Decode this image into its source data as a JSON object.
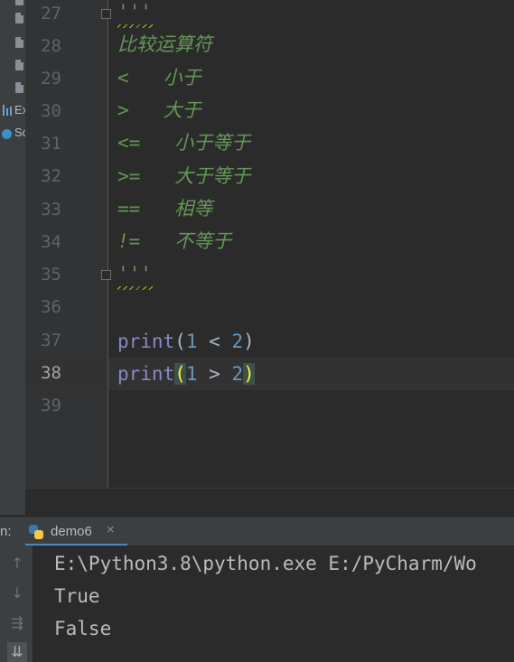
{
  "project_panel": {
    "items": [
      {
        "label": "Ex",
        "icon": "bar-chart-icon"
      },
      {
        "label": "Sc",
        "icon": "scratch-icon"
      }
    ]
  },
  "editor": {
    "lines": [
      {
        "num": "27",
        "text": "'''"
      },
      {
        "num": "28",
        "text": "比较运算符"
      },
      {
        "num": "29",
        "text": "<   小于"
      },
      {
        "num": "30",
        "text": ">   大于"
      },
      {
        "num": "31",
        "text": "<=   小于等于"
      },
      {
        "num": "32",
        "text": ">=   大于等于"
      },
      {
        "num": "33",
        "text": "==   相等"
      },
      {
        "num": "34",
        "text": "!=   不等于"
      },
      {
        "num": "35",
        "text": "'''"
      },
      {
        "num": "36",
        "text": ""
      },
      {
        "num": "37",
        "tokens": {
          "fn": "print",
          "open": "(",
          "a": "1",
          "op": " < ",
          "b": "2",
          "close": ")"
        }
      },
      {
        "num": "38",
        "tokens": {
          "fn": "print",
          "open": "(",
          "a": "1",
          "op": " > ",
          "b": "2",
          "close": ")"
        }
      },
      {
        "num": "39",
        "text": ""
      }
    ],
    "current_line": "38"
  },
  "run_panel": {
    "prefix": "n:",
    "tab": {
      "label": "demo6",
      "close": "×"
    },
    "output": [
      "E:\\Python3.8\\python.exe E:/PyCharm/Wo",
      "True",
      "False"
    ]
  },
  "colors": {
    "docstring": "#629755",
    "keyword": "#8888c6",
    "number": "#6897bb",
    "paren_highlight": "#ffef28"
  }
}
